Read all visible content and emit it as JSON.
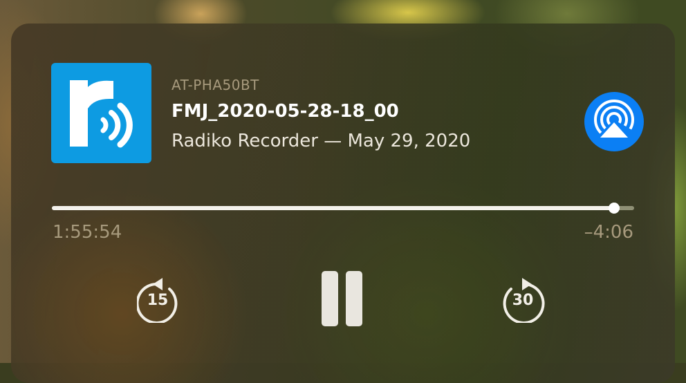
{
  "now_playing": {
    "device": "AT-PHA50BT",
    "title": "FMJ_2020-05-28-18_00",
    "subtitle": "Radiko Recorder — May 29, 2020",
    "artwork_icon": "radiko-logo-icon",
    "airplay_icon": "airplay-icon"
  },
  "progress": {
    "elapsed": "1:55:54",
    "remaining": "–4:06",
    "fraction": 0.966
  },
  "controls": {
    "skip_back_label": "15",
    "skip_forward_label": "30",
    "pause_icon": "pause-icon"
  },
  "colors": {
    "artwork_bg": "#0d9be2",
    "airplay_bg": "#0b7ff4"
  }
}
